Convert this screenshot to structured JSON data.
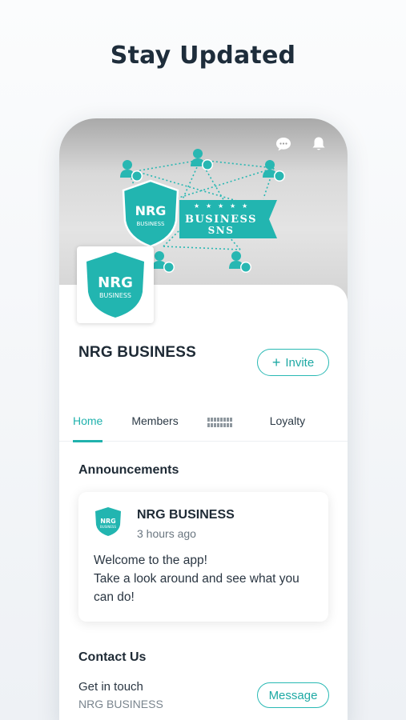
{
  "screen": {
    "headline": "Stay Updated"
  },
  "header": {
    "icons": [
      "chat-icon",
      "bell-icon"
    ]
  },
  "cover": {
    "banner_line1": "BUSINESS",
    "banner_line2": "SNS",
    "shield_brand": "NRG",
    "shield_sub": "BUSINESS"
  },
  "profile": {
    "logo_brand": "NRG",
    "logo_sub": "BUSINESS",
    "name": "NRG BUSINESS",
    "invite_label": "Invite"
  },
  "tabs": [
    {
      "label": "Home",
      "active": true
    },
    {
      "label": "Members",
      "active": false
    },
    {
      "label": "",
      "active": false
    },
    {
      "label": "Loyalty",
      "active": false
    }
  ],
  "announcements": {
    "title": "Announcements",
    "post": {
      "author": "NRG BUSINESS",
      "time": "3 hours ago",
      "body_lines": [
        "Welcome to the app!",
        "Take a look around and see what you",
        "can do!"
      ],
      "logo_brand": "NRG",
      "logo_sub": "BUSINESS"
    }
  },
  "contact": {
    "title": "Contact Us",
    "line1": "Get in touch",
    "line2": "NRG BUSINESS",
    "message_label": "Message"
  },
  "colors": {
    "accent": "#20b2ad",
    "text": "#1e2a35"
  }
}
